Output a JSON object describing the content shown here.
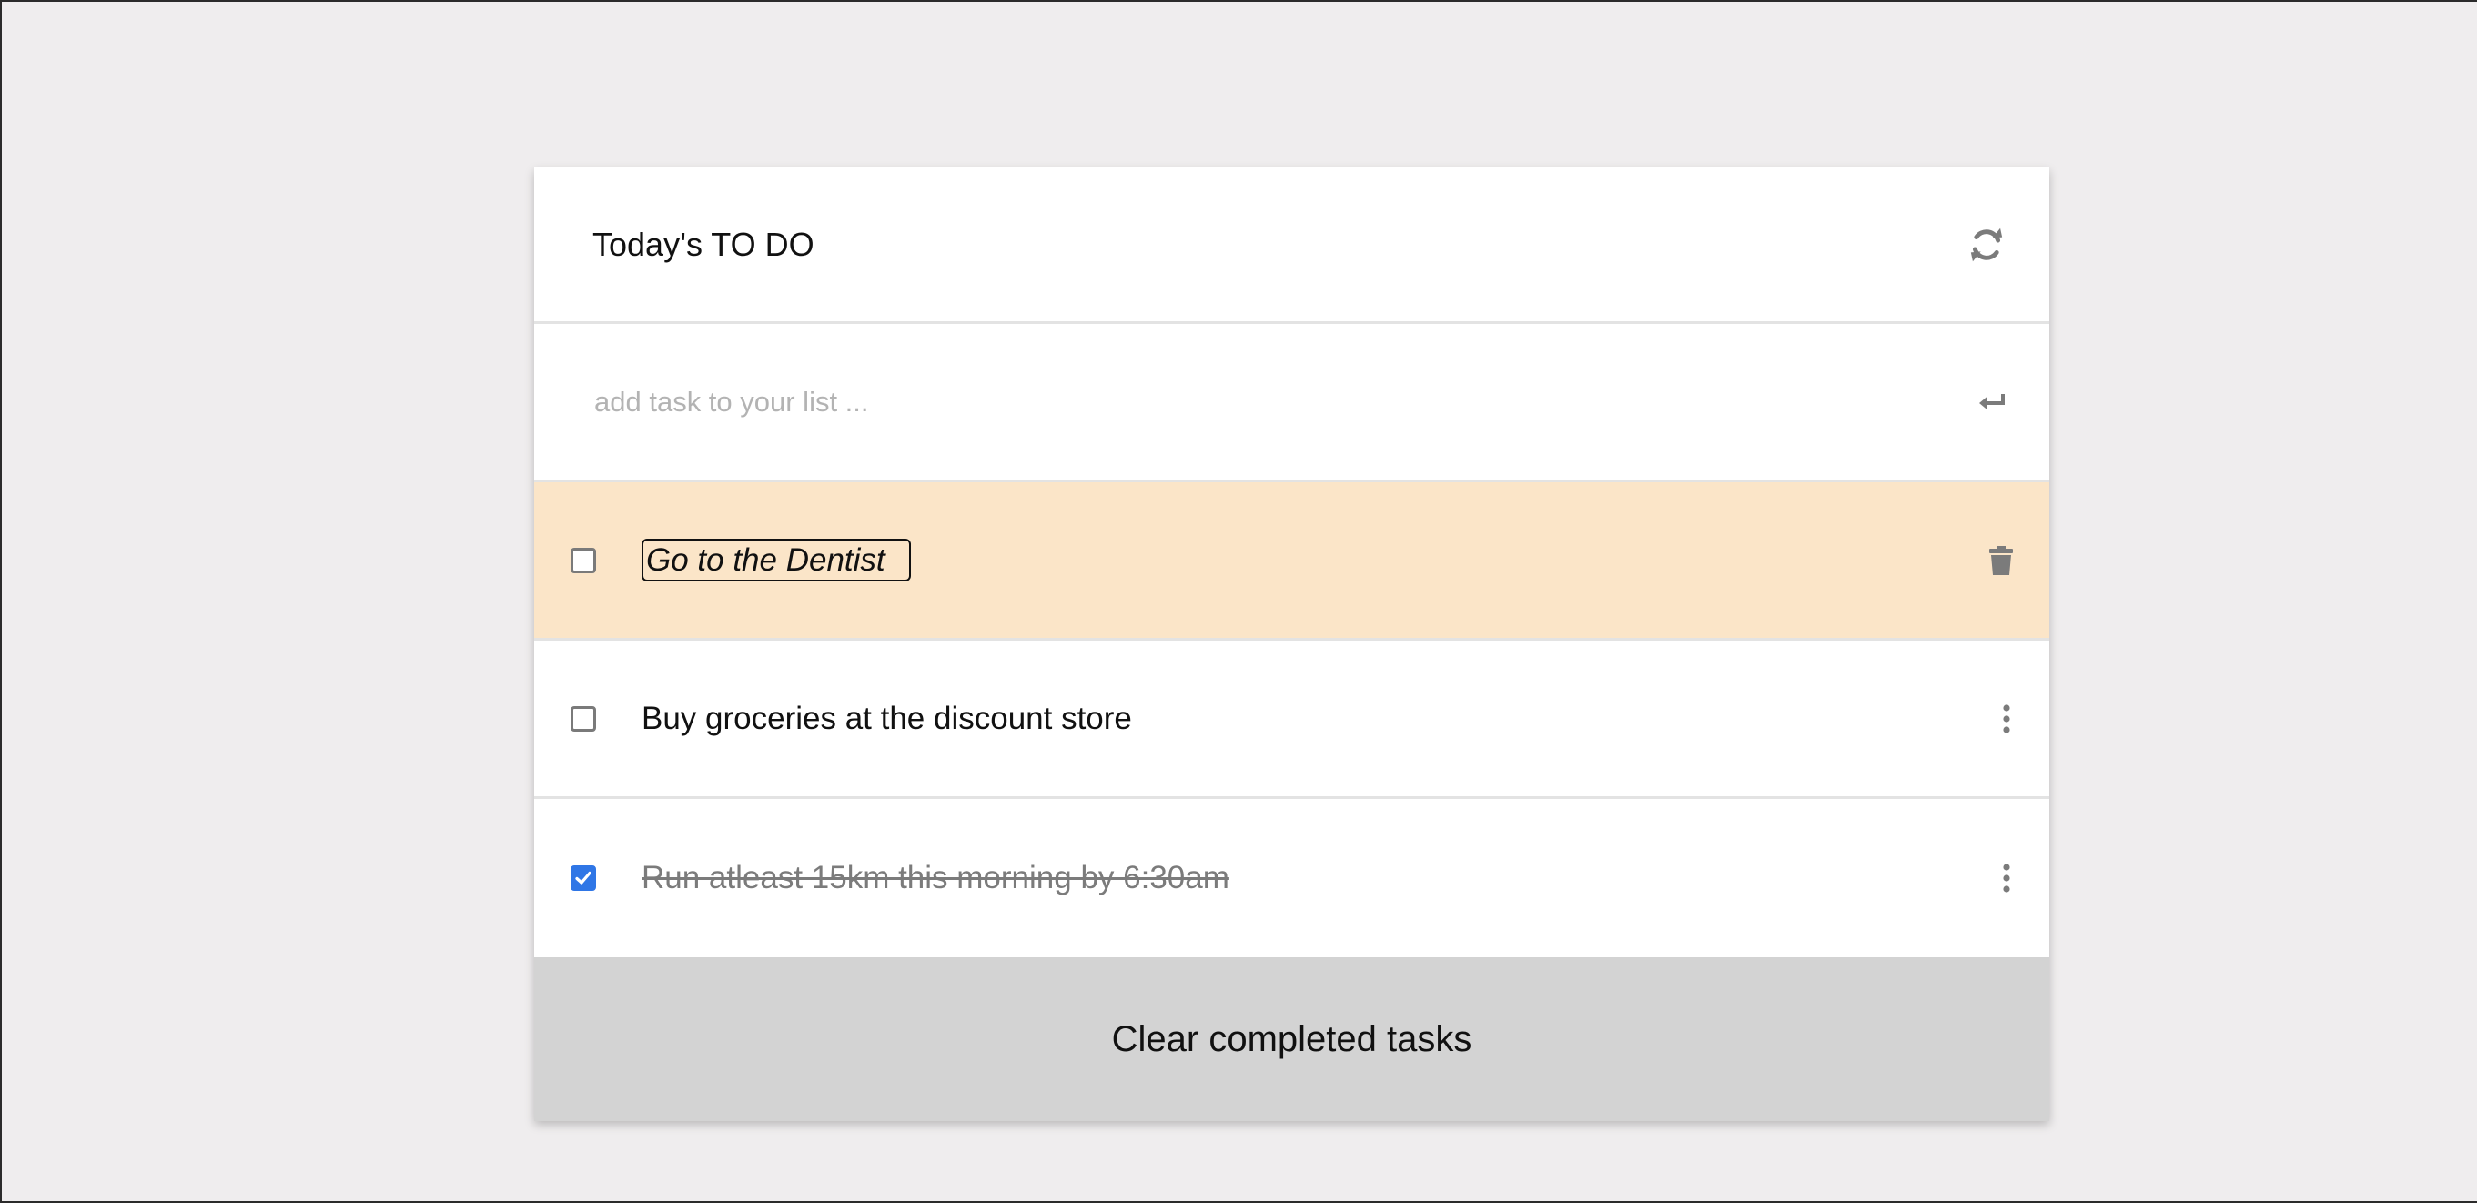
{
  "header": {
    "title": "Today's TO DO",
    "refresh_icon": "refresh-icon"
  },
  "add_task": {
    "placeholder": "add task to your list ...",
    "value": "",
    "submit_icon": "enter-return-icon"
  },
  "tasks": [
    {
      "text": "Go to the Dentist",
      "completed": false,
      "state": "editing",
      "action_icon": "trash-icon"
    },
    {
      "text": "Buy groceries at the discount store",
      "completed": false,
      "state": "normal",
      "action_icon": "more-vertical-icon"
    },
    {
      "text": "Run atleast 15km this morning by 6:30am",
      "completed": true,
      "state": "completed",
      "action_icon": "more-vertical-icon"
    }
  ],
  "footer": {
    "clear_label": "Clear completed tasks"
  },
  "colors": {
    "background": "#efedee",
    "card": "#ffffff",
    "highlight_row": "#fbe5c8",
    "footer": "#d3d3d3",
    "checkbox_checked": "#2f76e6",
    "icon": "#7b7b7b",
    "completed_text": "#7b7b7b"
  }
}
